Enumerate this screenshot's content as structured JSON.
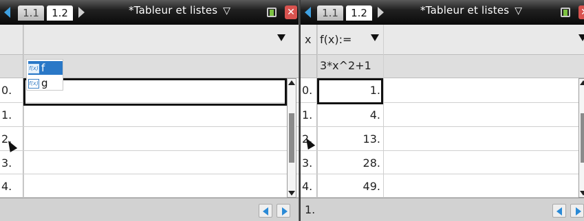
{
  "left": {
    "tabs": [
      "1.1",
      "1.2"
    ],
    "title": "*Tableur et listes",
    "popup_items": [
      "f",
      "g"
    ],
    "rows": [
      "0.",
      "1.",
      "2.",
      "3.",
      "4."
    ]
  },
  "right": {
    "tabs": [
      "1.1",
      "1.2"
    ],
    "title": "*Tableur et listes",
    "column_label": "x",
    "header": "f(x):=",
    "formula": "3*x^2+1",
    "rows": [
      "0.",
      "1.",
      "2.",
      "3.",
      "4."
    ],
    "values": [
      "1.",
      "4.",
      "13.",
      "28.",
      "49."
    ],
    "status": "1."
  },
  "colors": {
    "titlebar": "#111111",
    "accent_blue": "#2a78c7",
    "close_red": "#d9534f",
    "battery_green": "#7dc242"
  },
  "icons": {
    "tab_left": "triangle-left-icon",
    "tab_right": "triangle-right-icon",
    "title_menu": "chevron-down-icon",
    "battery": "battery-icon",
    "close": "close-icon",
    "function": "function-icon",
    "nav_left": "nav-left-icon",
    "nav_right": "nav-right-icon"
  }
}
